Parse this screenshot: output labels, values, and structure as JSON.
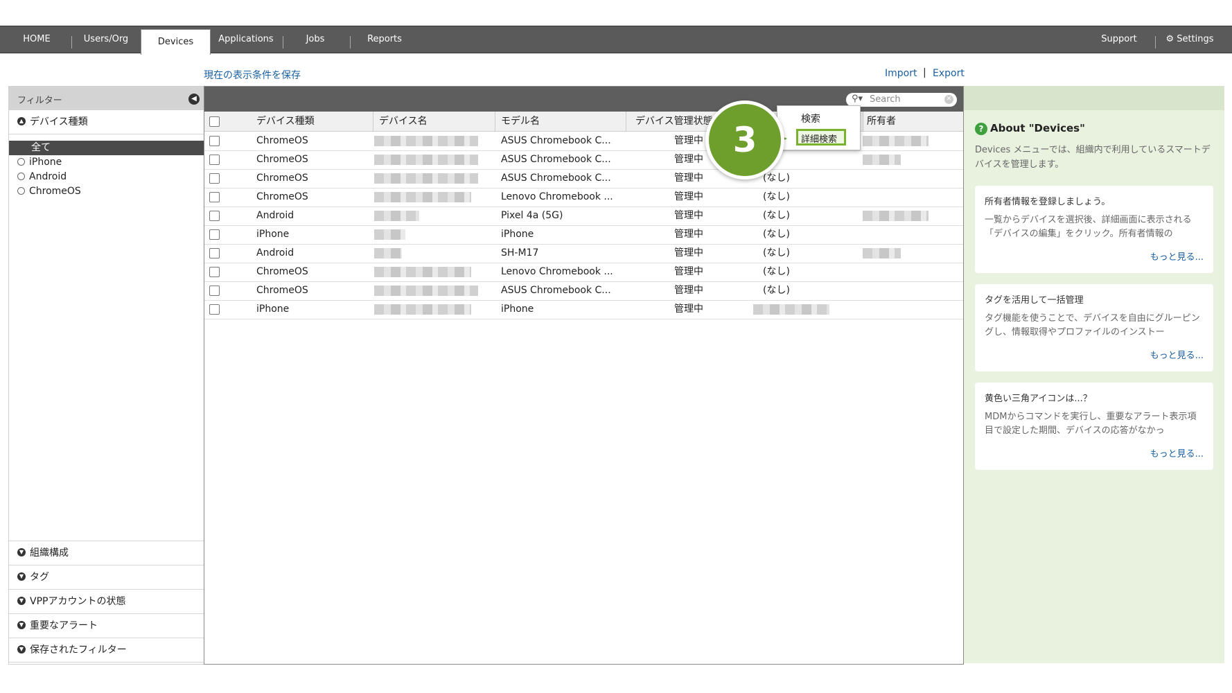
{
  "nav": {
    "tabs": [
      "HOME",
      "Users/Org",
      "Devices",
      "Applications",
      "Jobs",
      "Reports"
    ],
    "active_tab": "Devices",
    "support": "Support",
    "settings": "Settings"
  },
  "links": {
    "save_view": "現在の表示条件を保存",
    "import": "Import",
    "separator": "|",
    "export": "Export"
  },
  "sidebar": {
    "filter_title": "フィルター",
    "device_type_header": "デバイス種類",
    "device_types": [
      "全て",
      "iPhone",
      "Android",
      "ChromeOS"
    ],
    "selected_device_type": "全て",
    "sections": [
      "組織構成",
      "タグ",
      "VPPアカウントの状態",
      "重要なアラート",
      "保存されたフィルター"
    ]
  },
  "search": {
    "placeholder": "Search",
    "menu": [
      "検索",
      "詳細検索"
    ],
    "highlighted": "詳細検索"
  },
  "step_badge": "3",
  "table": {
    "headers": [
      "デバイス種類",
      "デバイス名",
      "モデル名",
      "デバイス管理状態",
      "",
      "所有者"
    ],
    "rows": [
      {
        "type": "ChromeOS",
        "model": "ASUS Chromebook C...",
        "status": "管理中",
        "extra": ""
      },
      {
        "type": "ChromeOS",
        "model": "ASUS Chromebook C...",
        "status": "管理中",
        "extra": ""
      },
      {
        "type": "ChromeOS",
        "model": "ASUS Chromebook C...",
        "status": "管理中",
        "extra": "(なし)"
      },
      {
        "type": "ChromeOS",
        "model": "Lenovo Chromebook ...",
        "status": "管理中",
        "extra": "(なし)"
      },
      {
        "type": "Android",
        "model": "Pixel 4a (5G)",
        "status": "管理中",
        "extra": "(なし)"
      },
      {
        "type": "iPhone",
        "model": "iPhone",
        "status": "管理中",
        "extra": "(なし)"
      },
      {
        "type": "Android",
        "model": "SH-M17",
        "status": "管理中",
        "extra": "(なし)"
      },
      {
        "type": "ChromeOS",
        "model": "Lenovo Chromebook ...",
        "status": "管理中",
        "extra": "(なし)"
      },
      {
        "type": "ChromeOS",
        "model": "ASUS Chromebook C...",
        "status": "管理中",
        "extra": "(なし)"
      },
      {
        "type": "iPhone",
        "model": "iPhone",
        "status": "管理中",
        "extra": ""
      }
    ]
  },
  "help": {
    "title": "About \"Devices\"",
    "intro": "Devices メニューでは、組織内で利用しているスマートデバイスを管理します。",
    "cards": [
      {
        "title": "所有者情報を登録しましょう。",
        "body": "一覧からデバイスを選択後、詳細画面に表示される「デバイスの編集」をクリック。所有者情報の",
        "more": "もっと見る..."
      },
      {
        "title": "タグを活用して一括管理",
        "body": "タグ機能を使うことで、デバイスを自由にグルーピングし、情報取得やプロファイルのインストー",
        "more": "もっと見る..."
      },
      {
        "title": "黄色い三角アイコンは...？",
        "body": "MDMからコマンドを実行し、重要なアラート表示項目で設定した期間、デバイスの応答がなかっ",
        "more": "もっと見る..."
      }
    ]
  },
  "colors": {
    "nav_bg": "#5a5a5a",
    "accent_green": "#6e9e2c",
    "link_blue": "#1a5fa0",
    "help_bg": "#e9f1df"
  }
}
